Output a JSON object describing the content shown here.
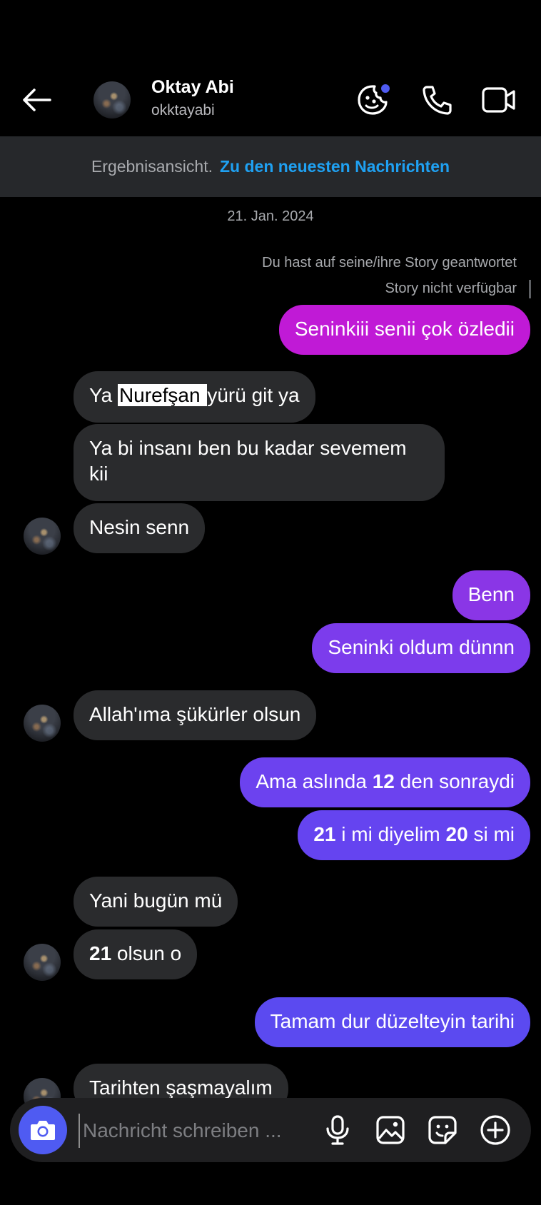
{
  "header": {
    "name": "Oktay Abi",
    "username": "okktayabi"
  },
  "banner": {
    "label": "Ergebnisansicht.",
    "link": "Zu den neuesten Nachrichten"
  },
  "date": "21. Jan. 2024",
  "story": {
    "reply_note": "Du hast auf seine/ihre Story geantwortet",
    "unavailable": "Story nicht verfügbar"
  },
  "messages": [
    {
      "from": "me",
      "text": "Seninkiii senii çok özledii"
    },
    {
      "from": "them",
      "parts": [
        "Ya ",
        "Nurefşan ",
        "yürü git ya"
      ]
    },
    {
      "from": "them",
      "text": "Ya bi insanı ben bu kadar sevemem kii"
    },
    {
      "from": "them",
      "text": "Nesin senn"
    },
    {
      "from": "me",
      "text": "Benn"
    },
    {
      "from": "me",
      "text": "Seninki oldum dünnn"
    },
    {
      "from": "them",
      "text": "Allah'ıma şükürler olsun"
    },
    {
      "from": "me",
      "parts": [
        "Ama aslında ",
        "12",
        " den sonraydi"
      ]
    },
    {
      "from": "me",
      "parts": [
        "21",
        " i mi diyelim ",
        "20",
        " si mi"
      ]
    },
    {
      "from": "them",
      "text": "Yani bugün mü"
    },
    {
      "from": "them",
      "parts": [
        "21",
        " olsun o"
      ]
    },
    {
      "from": "me",
      "text": "Tamam dur düzelteyin tarihi"
    },
    {
      "from": "them",
      "text": "Tarihten şaşmayalım"
    }
  ],
  "composer": {
    "placeholder": "Nachricht schreiben ..."
  },
  "colors": {
    "background": "#000000",
    "incoming_bubble": "#2a2b2d",
    "outgoing_gradient": [
      "#c01ad6",
      "#5b4af0"
    ],
    "link": "#1fa1f2",
    "camera_button": "#4f5bf2"
  },
  "icons": [
    "back-arrow-icon",
    "effects-icon",
    "phone-icon",
    "video-icon",
    "camera-icon",
    "microphone-icon",
    "gallery-icon",
    "sticker-icon",
    "plus-icon"
  ]
}
